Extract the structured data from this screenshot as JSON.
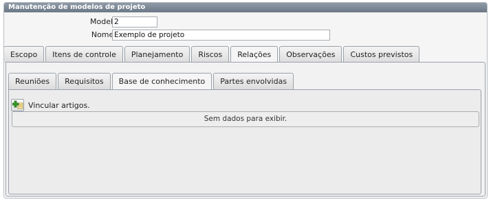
{
  "panel": {
    "title": "Manutenção de modelos de projeto"
  },
  "form": {
    "modelo_label": "Modelo :",
    "modelo_value": "2",
    "nome_label": "Nome",
    "nome_required": "*",
    "nome_colon": " :",
    "nome_value": "Exemplo de projeto"
  },
  "main_tabs": [
    {
      "label": "Escopo"
    },
    {
      "label": "Itens de controle"
    },
    {
      "label": "Planejamento"
    },
    {
      "label": "Riscos"
    },
    {
      "label": "Relações",
      "active": true
    },
    {
      "label": "Observações"
    },
    {
      "label": "Custos previstos"
    }
  ],
  "sub_tabs": [
    {
      "label": "Reuniões"
    },
    {
      "label": "Requisitos"
    },
    {
      "label": "Base de conhecimento",
      "active": true
    },
    {
      "label": "Partes envolvidas"
    }
  ],
  "toolbar": {
    "link_label": "Vincular artigos.",
    "add_icon": "add-link-icon"
  },
  "grid": {
    "empty_text": "Sem dados para exibir."
  },
  "colors": {
    "header": "#7b8694",
    "required": "#d21a1a",
    "add_icon_green": "#3a9a2a"
  }
}
